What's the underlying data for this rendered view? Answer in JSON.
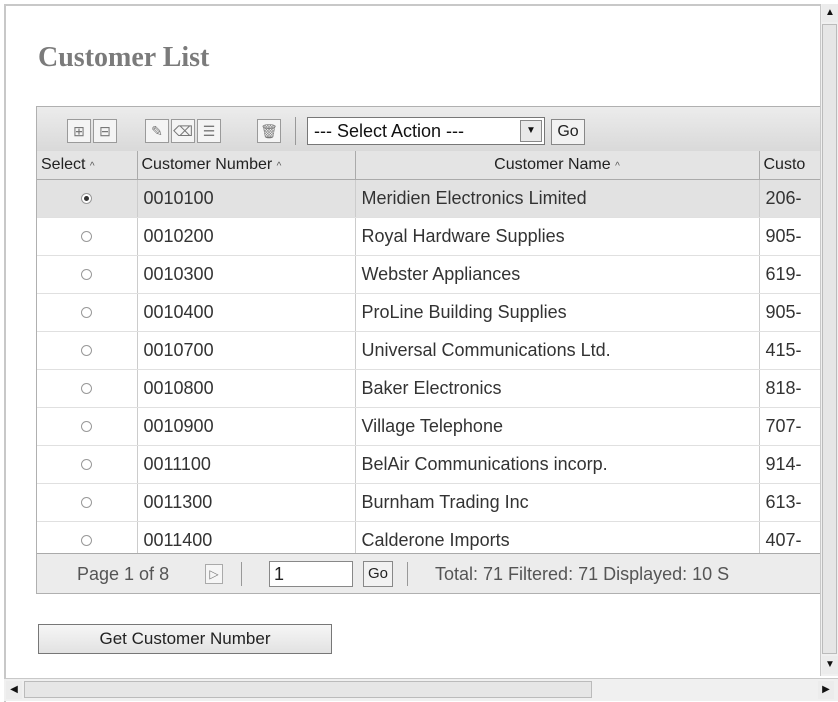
{
  "page": {
    "title": "Customer List"
  },
  "toolbar": {
    "icons": [
      "expand-rows-icon",
      "collapse-rows-icon",
      "edit-pencil-icon",
      "erase-icon",
      "details-icon",
      "delete-trash-icon"
    ],
    "select_action": "--- Select Action ---",
    "go_label": "Go"
  },
  "table": {
    "columns": [
      "Select",
      "Customer Number",
      "Customer Name",
      "Custo"
    ],
    "sort_glyph": "^",
    "rows": [
      {
        "selected": true,
        "number": "0010100",
        "name": "Meridien Electronics Limited",
        "phone": "206-"
      },
      {
        "selected": false,
        "number": "0010200",
        "name": "Royal Hardware Supplies",
        "phone": "905-"
      },
      {
        "selected": false,
        "number": "0010300",
        "name": "Webster Appliances",
        "phone": "619-"
      },
      {
        "selected": false,
        "number": "0010400",
        "name": "ProLine Building Supplies",
        "phone": "905-"
      },
      {
        "selected": false,
        "number": "0010700",
        "name": "Universal Communications Ltd.",
        "phone": "415-"
      },
      {
        "selected": false,
        "number": "0010800",
        "name": "Baker Electronics",
        "phone": "818-"
      },
      {
        "selected": false,
        "number": "0010900",
        "name": "Village Telephone",
        "phone": "707-"
      },
      {
        "selected": false,
        "number": "0011100",
        "name": "BelAir Communications incorp.",
        "phone": "914-"
      },
      {
        "selected": false,
        "number": "0011300",
        "name": "Burnham Trading Inc",
        "phone": "613-"
      },
      {
        "selected": false,
        "number": "0011400",
        "name": "Calderone Imports",
        "phone": "407-"
      }
    ]
  },
  "pager": {
    "page_text": "Page 1 of 8",
    "page_input": "1",
    "go_label": "Go",
    "info": "Total: 71 Filtered: 71 Displayed: 10 S"
  },
  "actions": {
    "get_customer_number": "Get Customer Number"
  },
  "scroll": {
    "up": "▲",
    "down": "▼",
    "left": "◀",
    "right": "▶"
  },
  "colors": {
    "title": "#7b7b7b",
    "selected_row": "#e2e2e2",
    "header": "#e4e4e4"
  }
}
